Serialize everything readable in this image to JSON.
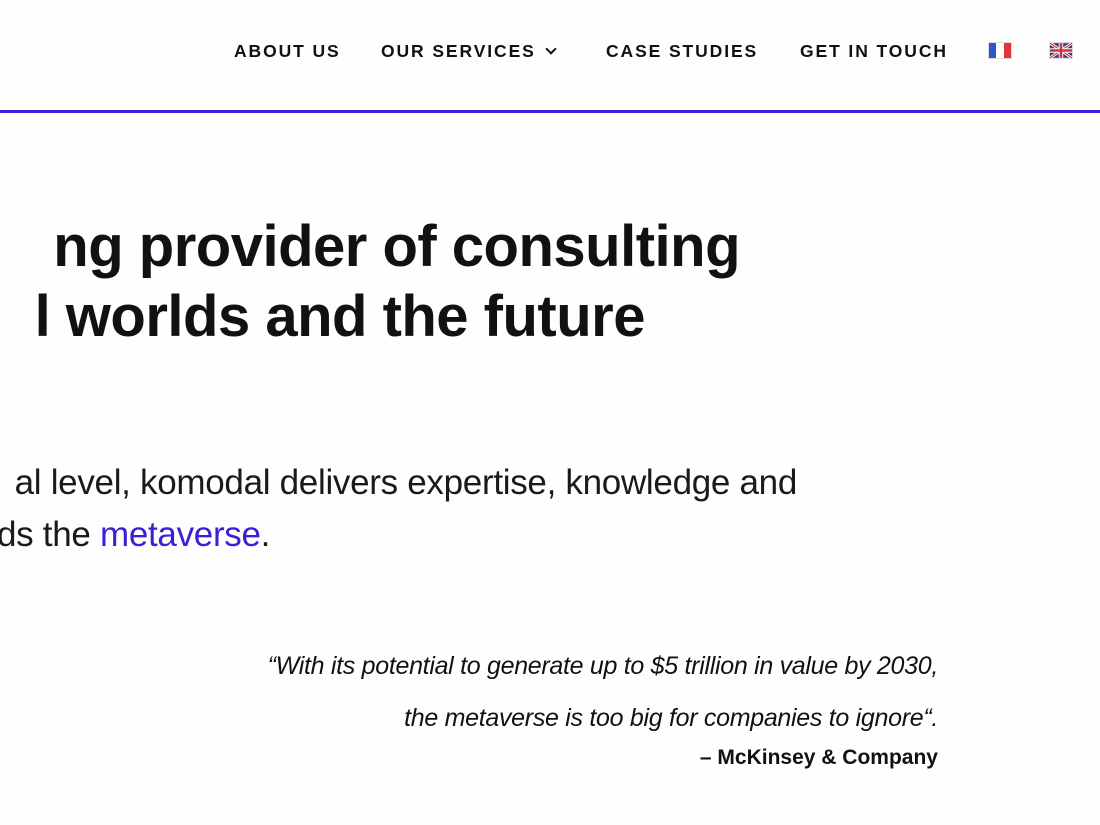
{
  "nav": {
    "about": "ABOUT US",
    "services": "OUR SERVICES",
    "cases": "CASE STUDIES",
    "touch": "GET IN TOUCH",
    "lang_fr": "flag-fr-icon",
    "lang_en": "flag-uk-icon"
  },
  "colors": {
    "accent": "#3a1fd6",
    "text": "#111111"
  },
  "hero": {
    "headline_line1": "ng provider of consulting",
    "headline_line2": "l worlds and the future",
    "intro_line1": "al level, komodal delivers expertise, knowledge and",
    "intro_line2_prefix": "ds the ",
    "intro_link": "metaverse",
    "intro_line2_suffix": "."
  },
  "quote": {
    "line1": "“With its potential to generate up to $5 trillion in value by 2030,",
    "line2": "the metaverse is too big for companies to ignore“.",
    "author": "– McKinsey & Company"
  }
}
